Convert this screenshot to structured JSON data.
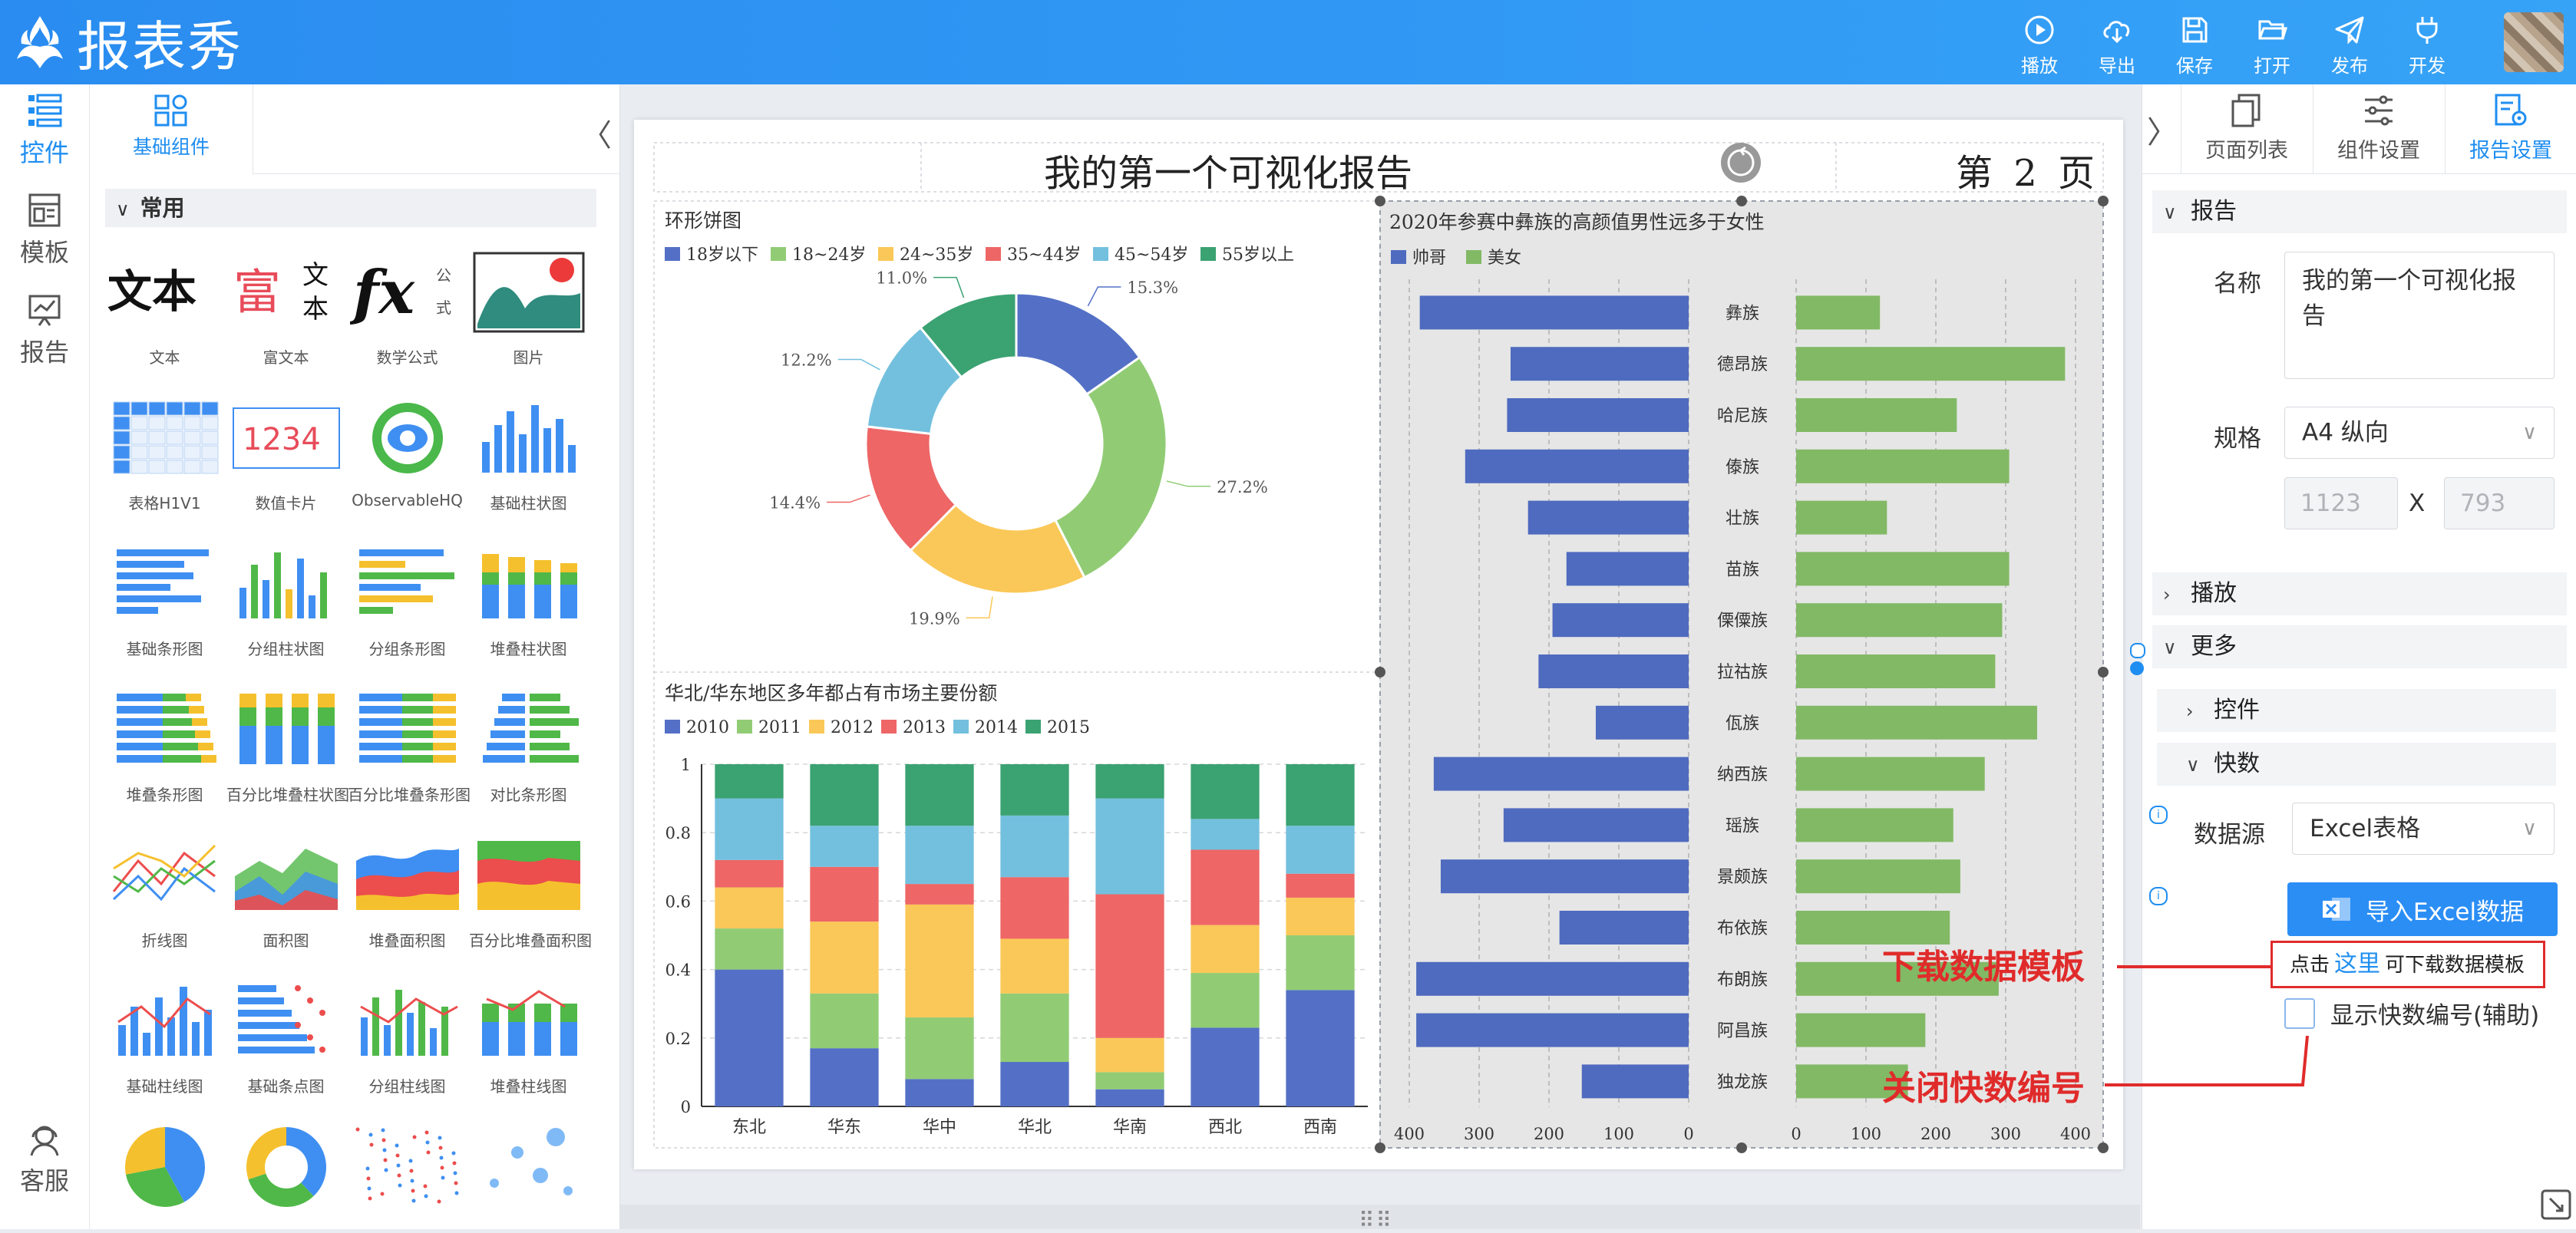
{
  "app": {
    "title": "报表秀"
  },
  "toolbar": [
    {
      "id": "play",
      "label": "播放",
      "icon": "play-icon"
    },
    {
      "id": "export",
      "label": "导出",
      "icon": "cloud-download-icon"
    },
    {
      "id": "save",
      "label": "保存",
      "icon": "save-icon"
    },
    {
      "id": "open",
      "label": "打开",
      "icon": "folder-open-icon"
    },
    {
      "id": "publish",
      "label": "发布",
      "icon": "paper-plane-icon"
    },
    {
      "id": "develop",
      "label": "开发",
      "icon": "plug-icon"
    }
  ],
  "leftnav": {
    "items": [
      {
        "label": "控件",
        "icon": "widgets-icon",
        "active": true
      },
      {
        "label": "模板",
        "icon": "template-icon"
      },
      {
        "label": "报告",
        "icon": "report-icon"
      }
    ],
    "service": "客服"
  },
  "widgets": {
    "tab": "基础组件",
    "section": "常用",
    "collapse_glyph": "〈",
    "items": [
      {
        "label": "文本",
        "icon": "text-widget-icon",
        "glyph": "文本"
      },
      {
        "label": "富文本",
        "icon": "rich-text-icon",
        "glyph": "富",
        "glyph2": "文",
        "glyph3": "本"
      },
      {
        "label": "数学公式",
        "icon": "formula-icon",
        "glyph": "fx",
        "glyph2": "公",
        "glyph3": "式"
      },
      {
        "label": "图片",
        "icon": "image-icon"
      },
      {
        "label": "表格H1V1",
        "icon": "table-icon"
      },
      {
        "label": "数值卡片",
        "icon": "number-card-icon",
        "glyph": "1234"
      },
      {
        "label": "ObservableHQ",
        "icon": "observablehq-icon"
      },
      {
        "label": "基础柱状图",
        "icon": "bar-chart-icon"
      },
      {
        "label": "基础条形图",
        "icon": "hbar-chart-icon"
      },
      {
        "label": "分组柱状图",
        "icon": "grouped-bar-icon"
      },
      {
        "label": "分组条形图",
        "icon": "grouped-hbar-icon"
      },
      {
        "label": "堆叠柱状图",
        "icon": "stacked-bar-icon"
      },
      {
        "label": "堆叠条形图",
        "icon": "stacked-hbar-icon"
      },
      {
        "label": "百分比堆叠柱状图",
        "icon": "percent-stacked-bar-icon"
      },
      {
        "label": "百分比堆叠条形图",
        "icon": "percent-stacked-hbar-icon"
      },
      {
        "label": "对比条形图",
        "icon": "compare-hbar-icon"
      },
      {
        "label": "折线图",
        "icon": "line-chart-icon"
      },
      {
        "label": "面积图",
        "icon": "area-chart-icon"
      },
      {
        "label": "堆叠面积图",
        "icon": "stacked-area-icon"
      },
      {
        "label": "百分比堆叠面积图",
        "icon": "percent-stacked-area-icon"
      },
      {
        "label": "基础柱线图",
        "icon": "bar-line-icon"
      },
      {
        "label": "基础条点图",
        "icon": "hbar-dot-icon"
      },
      {
        "label": "分组柱线图",
        "icon": "grouped-bar-line-icon"
      },
      {
        "label": "堆叠柱线图",
        "icon": "stacked-bar-line-icon"
      },
      {
        "label": "",
        "icon": "pie-chart-icon"
      },
      {
        "label": "",
        "icon": "donut-chart-icon"
      },
      {
        "label": "",
        "icon": "scatter-icon"
      },
      {
        "label": "",
        "icon": "bubble-icon"
      }
    ]
  },
  "page": {
    "title": "我的第一个可视化报告",
    "page_number": "第 2 页"
  },
  "colors": {
    "blue": "#5470c6",
    "green": "#91cc75",
    "yellow": "#fac858",
    "red": "#ee6666",
    "cyan": "#73c0de",
    "teal": "#3ba272",
    "male": "#4f6bbf",
    "female": "#82b965"
  },
  "chart_data": [
    {
      "type": "pie",
      "title": "环形饼图",
      "categories": [
        "18岁以下",
        "18~24岁",
        "24~35岁",
        "35~44岁",
        "45~54岁",
        "55岁以上"
      ],
      "values": [
        15.3,
        27.2,
        19.9,
        14.4,
        12.2,
        11.0
      ],
      "value_labels": [
        "15.3%",
        "27.2%",
        "19.9%",
        "14.4%",
        "12.2%",
        "11.0%"
      ],
      "legend": "top-left",
      "donut": true
    },
    {
      "type": "bar",
      "stacked": "percent",
      "title": "华北/华东地区多年都占有市场主要份额",
      "categories": [
        "东北",
        "华东",
        "华中",
        "华北",
        "华南",
        "西北",
        "西南"
      ],
      "series": [
        {
          "name": "2010",
          "values": [
            0.4,
            0.17,
            0.08,
            0.13,
            0.05,
            0.23,
            0.34
          ]
        },
        {
          "name": "2011",
          "values": [
            0.12,
            0.16,
            0.18,
            0.2,
            0.05,
            0.16,
            0.16
          ]
        },
        {
          "name": "2012",
          "values": [
            0.12,
            0.21,
            0.33,
            0.16,
            0.1,
            0.14,
            0.11
          ]
        },
        {
          "name": "2013",
          "values": [
            0.08,
            0.16,
            0.06,
            0.18,
            0.42,
            0.22,
            0.07
          ]
        },
        {
          "name": "2014",
          "values": [
            0.18,
            0.12,
            0.17,
            0.18,
            0.28,
            0.09,
            0.14
          ]
        },
        {
          "name": "2015",
          "values": [
            0.1,
            0.18,
            0.18,
            0.15,
            0.1,
            0.16,
            0.18
          ]
        }
      ],
      "yticks": [
        "0",
        "0.2",
        "0.4",
        "0.6",
        "0.8",
        "1"
      ],
      "ylim": [
        0,
        1
      ],
      "legend": "top-left"
    },
    {
      "type": "bar",
      "orientation": "horizontal-butterfly",
      "title": "2020年参赛中彝族的高颜值男性远多于女性",
      "categories": [
        "彝族",
        "德昂族",
        "哈尼族",
        "傣族",
        "壮族",
        "苗族",
        "傈僳族",
        "拉祜族",
        "佤族",
        "纳西族",
        "瑶族",
        "景颇族",
        "布依族",
        "布朗族",
        "阿昌族",
        "独龙族"
      ],
      "series": [
        {
          "name": "帅哥",
          "values": [
            385,
            255,
            260,
            320,
            230,
            175,
            195,
            215,
            133,
            365,
            265,
            355,
            185,
            390,
            390,
            153
          ]
        },
        {
          "name": "美女",
          "values": [
            120,
            385,
            230,
            305,
            130,
            305,
            295,
            285,
            345,
            270,
            225,
            235,
            220,
            290,
            185,
            160
          ]
        }
      ],
      "xticks_left": [
        "400",
        "300",
        "200",
        "100",
        "0"
      ],
      "xticks_right": [
        "0",
        "100",
        "200",
        "300",
        "400"
      ],
      "xlim": [
        0,
        400
      ],
      "legend": "top-left"
    }
  ],
  "right": {
    "tabs": [
      {
        "label": "页面列表",
        "icon": "pages-icon"
      },
      {
        "label": "组件设置",
        "icon": "sliders-icon"
      },
      {
        "label": "报告设置",
        "icon": "report-settings-icon",
        "active": true
      }
    ],
    "sections": {
      "report": "报告",
      "play": "播放",
      "more": "更多",
      "widgets": "控件",
      "quick": "快数"
    },
    "name_label": "名称",
    "name_value": "我的第一个可视化报告",
    "spec_label": "规格",
    "spec_value": "A4 纵向",
    "width_placeholder": "1123",
    "height_placeholder": "793",
    "x_sep": "X",
    "datasource_label": "数据源",
    "datasource_value": "Excel表格",
    "import_label": "导入Excel数据",
    "dl_prefix": "点击",
    "dl_link": "这里",
    "dl_suffix": "可下载数据模板",
    "show_num_label": "显示快数编号(辅助)"
  },
  "annotations": {
    "download": "下载数据模板",
    "close": "关闭快数编号"
  }
}
